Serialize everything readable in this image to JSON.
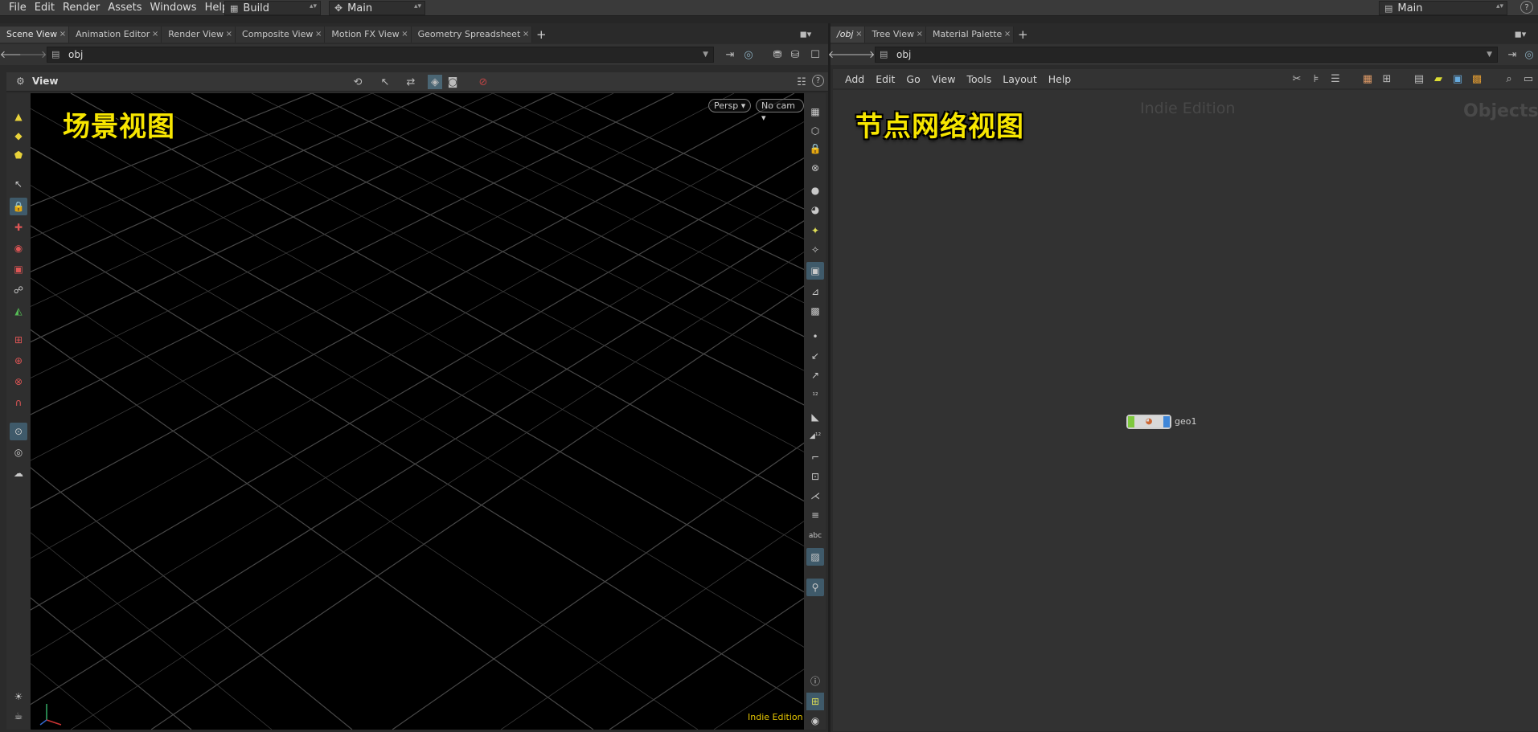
{
  "menubar": {
    "items": [
      "File",
      "Edit",
      "Render",
      "Assets",
      "Windows",
      "Help"
    ],
    "desktop_dropdown": "Build",
    "context_dropdown": "Main",
    "right_dropdown": "Main"
  },
  "left_pane": {
    "tabs": [
      "Scene View",
      "Animation Editor",
      "Render View",
      "Composite View",
      "Motion FX View",
      "Geometry Spreadsheet"
    ],
    "active_tab": 0,
    "path": "obj",
    "view_label": "View",
    "overlay_title": "场景视图",
    "persp_button": "Persp",
    "camera_button": "No cam",
    "edition_label": "Indie Edition"
  },
  "right_pane": {
    "tabs": [
      "/obj",
      "Tree View",
      "Material Palette"
    ],
    "active_tab": 0,
    "path": "obj",
    "menu": [
      "Add",
      "Edit",
      "Go",
      "View",
      "Tools",
      "Layout",
      "Help"
    ],
    "overlay_title": "节点网络视图",
    "edition_watermark": "Indie Edition",
    "context_watermark": "Objects",
    "node": {
      "name": "geo1"
    }
  },
  "colors": {
    "accent_yellow": "#f7e600",
    "viewport_bg": "#000000",
    "network_bg": "#323232"
  }
}
